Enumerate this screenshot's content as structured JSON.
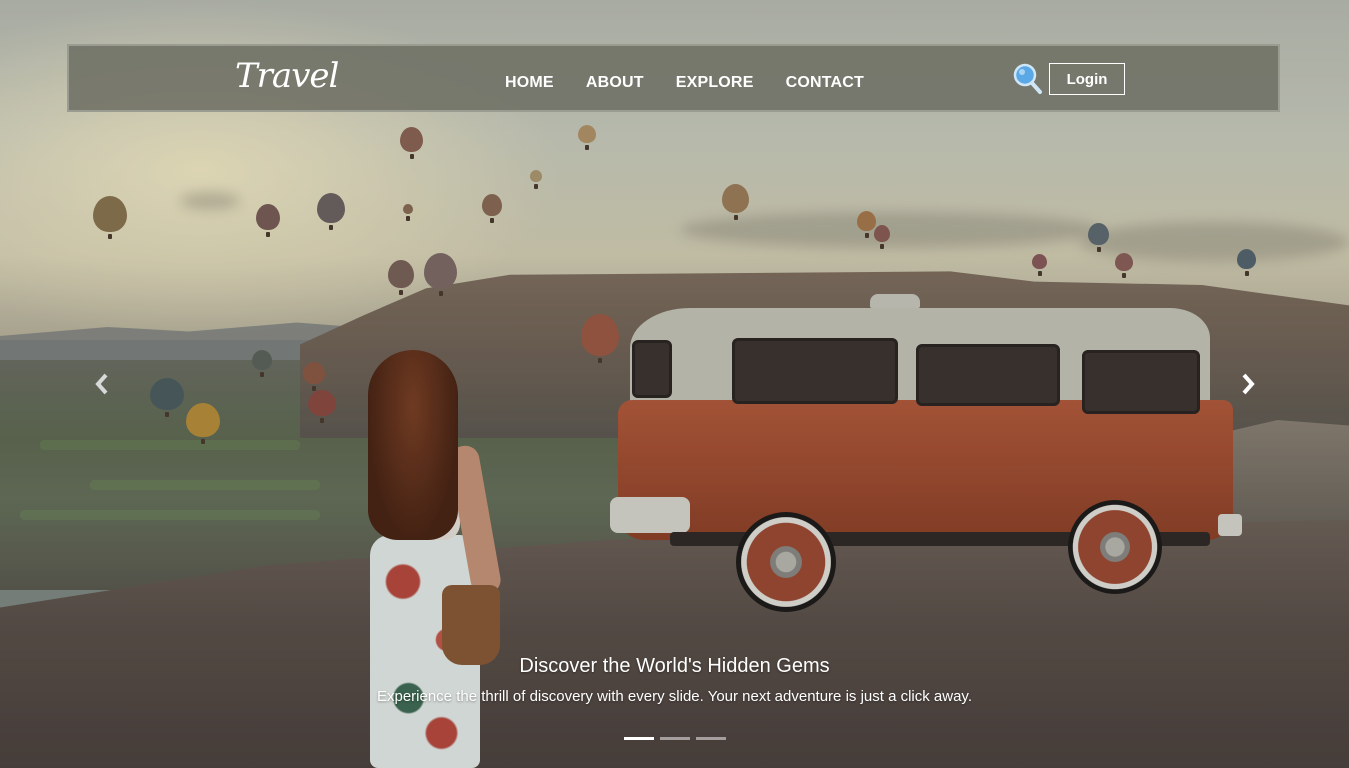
{
  "brand": {
    "logo_text": "Travel"
  },
  "nav": {
    "links": [
      {
        "label": "HOME"
      },
      {
        "label": "ABOUT"
      },
      {
        "label": "EXPLORE"
      },
      {
        "label": "CONTACT"
      }
    ],
    "search_icon": "magnifier-icon",
    "login_label": "Login"
  },
  "carousel": {
    "caption_title": "Discover the World's Hidden Gems",
    "caption_text": "Experience the thrill of discovery with every slide. Your next adventure is just a click away.",
    "slide_count": 3,
    "active_slide": 1,
    "prev_icon": "chevron-left-icon",
    "next_icon": "chevron-right-icon"
  },
  "colors": {
    "navbar_bg": "#6e7064",
    "text": "#ffffff",
    "search_icon": "#5aa9e6"
  }
}
